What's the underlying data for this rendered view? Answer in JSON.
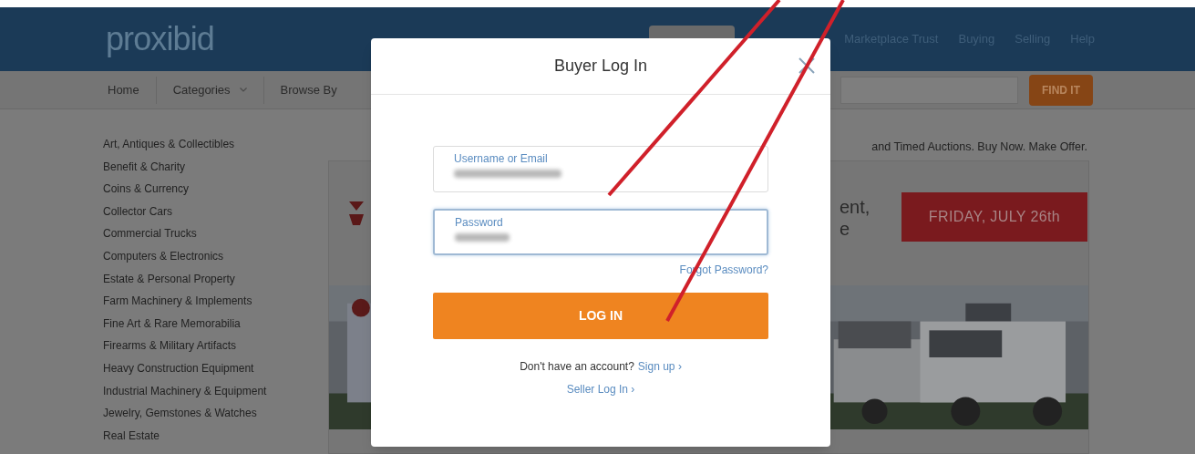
{
  "header": {
    "logo": "proxibid",
    "links": [
      {
        "label": "Marketplace Trust"
      },
      {
        "label": "Buying"
      },
      {
        "label": "Selling"
      },
      {
        "label": "Help"
      }
    ]
  },
  "nav": {
    "items": [
      {
        "label": "Home",
        "dropdown": false
      },
      {
        "label": "Categories",
        "dropdown": true
      },
      {
        "label": "Browse By",
        "dropdown": false
      }
    ],
    "search_button": "FIND IT"
  },
  "sidebar": {
    "categories": [
      "Art, Antiques & Collectibles",
      "Benefit & Charity",
      "Coins & Currency",
      "Collector Cars",
      "Commercial Trucks",
      "Computers & Electronics",
      "Estate & Personal Property",
      "Farm Machinery & Implements",
      "Fine Art & Rare Memorabilia",
      "Firearms & Military Artifacts",
      "Heavy Construction Equipment",
      "Industrial Machinery & Equipment",
      "Jewelry, Gemstones & Watches",
      "Real Estate"
    ]
  },
  "tagline": "and Timed Auctions. Buy Now. Make Offer.",
  "banner": {
    "headline_fragments": [
      "ent,",
      "e"
    ],
    "date_badge": "FRIDAY, JULY 26th"
  },
  "modal": {
    "title": "Buyer Log In",
    "fields": [
      {
        "label": "Username or Email",
        "focused": false
      },
      {
        "label": "Password",
        "focused": true
      }
    ],
    "forgot_link": "Forgot Password?",
    "submit": "LOG IN",
    "signup_prompt": "Don't have an account?",
    "signup_link": "Sign up ›",
    "seller_link": "Seller Log In ›"
  }
}
